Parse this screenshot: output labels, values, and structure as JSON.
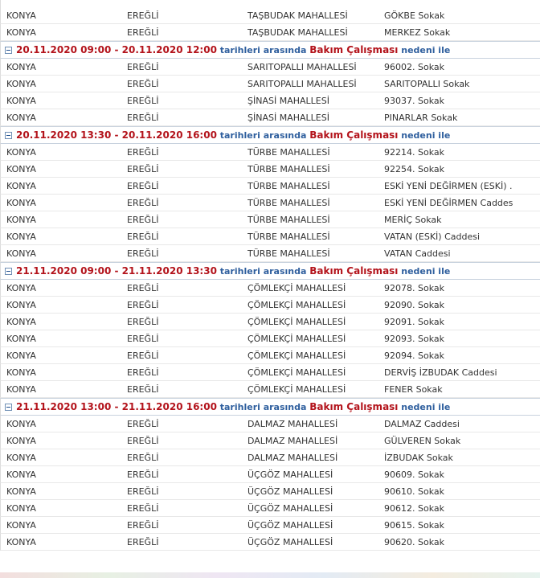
{
  "groups": [
    {
      "header": null,
      "rows": [
        [
          "KONYA",
          "EREĞLİ",
          "TAŞBUDAK MAHALLESİ",
          "GÖKBE Sokak"
        ],
        [
          "KONYA",
          "EREĞLİ",
          "TAŞBUDAK MAHALLESİ",
          "MERKEZ Sokak"
        ]
      ]
    },
    {
      "header": {
        "dates": "20.11.2020 09:00 - 20.11.2020 12:00",
        "between": "tarihleri arasında",
        "reason": "Bakım Çalışması",
        "suffix": "nedeni ile"
      },
      "rows": [
        [
          "KONYA",
          "EREĞLİ",
          "SARITOPALLI MAHALLESİ",
          "96002. Sokak"
        ],
        [
          "KONYA",
          "EREĞLİ",
          "SARITOPALLI MAHALLESİ",
          "SARITOPALLI Sokak"
        ],
        [
          "KONYA",
          "EREĞLİ",
          "ŞİNASİ MAHALLESİ",
          "93037. Sokak"
        ],
        [
          "KONYA",
          "EREĞLİ",
          "ŞİNASİ MAHALLESİ",
          "PINARLAR Sokak"
        ]
      ]
    },
    {
      "header": {
        "dates": "20.11.2020 13:30 - 20.11.2020 16:00",
        "between": "tarihleri arasında",
        "reason": "Bakım Çalışması",
        "suffix": "nedeni ile"
      },
      "rows": [
        [
          "KONYA",
          "EREĞLİ",
          "TÜRBE MAHALLESİ",
          "92214. Sokak"
        ],
        [
          "KONYA",
          "EREĞLİ",
          "TÜRBE MAHALLESİ",
          "92254. Sokak"
        ],
        [
          "KONYA",
          "EREĞLİ",
          "TÜRBE MAHALLESİ",
          "ESKİ YENİ DEĞİRMEN (ESKİ) ..."
        ],
        [
          "KONYA",
          "EREĞLİ",
          "TÜRBE MAHALLESİ",
          "ESKİ YENİ DEĞİRMEN Caddesi"
        ],
        [
          "KONYA",
          "EREĞLİ",
          "TÜRBE MAHALLESİ",
          "MERİÇ Sokak"
        ],
        [
          "KONYA",
          "EREĞLİ",
          "TÜRBE MAHALLESİ",
          "VATAN (ESKİ) Caddesi"
        ],
        [
          "KONYA",
          "EREĞLİ",
          "TÜRBE MAHALLESİ",
          "VATAN Caddesi"
        ]
      ]
    },
    {
      "header": {
        "dates": "21.11.2020 09:00 - 21.11.2020 13:30",
        "between": "tarihleri arasında",
        "reason": "Bakım Çalışması",
        "suffix": "nedeni ile"
      },
      "rows": [
        [
          "KONYA",
          "EREĞLİ",
          "ÇÖMLEKÇİ MAHALLESİ",
          "92078. Sokak"
        ],
        [
          "KONYA",
          "EREĞLİ",
          "ÇÖMLEKÇİ MAHALLESİ",
          "92090. Sokak"
        ],
        [
          "KONYA",
          "EREĞLİ",
          "ÇÖMLEKÇİ MAHALLESİ",
          "92091. Sokak"
        ],
        [
          "KONYA",
          "EREĞLİ",
          "ÇÖMLEKÇİ MAHALLESİ",
          "92093. Sokak"
        ],
        [
          "KONYA",
          "EREĞLİ",
          "ÇÖMLEKÇİ MAHALLESİ",
          "92094. Sokak"
        ],
        [
          "KONYA",
          "EREĞLİ",
          "ÇÖMLEKÇİ MAHALLESİ",
          "DERVİŞ İZBUDAK Caddesi"
        ],
        [
          "KONYA",
          "EREĞLİ",
          "ÇÖMLEKÇİ MAHALLESİ",
          "FENER Sokak"
        ]
      ]
    },
    {
      "header": {
        "dates": "21.11.2020 13:00 - 21.11.2020 16:00",
        "between": "tarihleri arasında",
        "reason": "Bakım Çalışması",
        "suffix": "nedeni ile"
      },
      "rows": [
        [
          "KONYA",
          "EREĞLİ",
          "DALMAZ MAHALLESİ",
          "DALMAZ Caddesi"
        ],
        [
          "KONYA",
          "EREĞLİ",
          "DALMAZ MAHALLESİ",
          "GÜLVEREN Sokak"
        ],
        [
          "KONYA",
          "EREĞLİ",
          "DALMAZ MAHALLESİ",
          "İZBUDAK Sokak"
        ],
        [
          "KONYA",
          "EREĞLİ",
          "ÜÇGÖZ MAHALLESİ",
          "90609. Sokak"
        ],
        [
          "KONYA",
          "EREĞLİ",
          "ÜÇGÖZ MAHALLESİ",
          "90610. Sokak"
        ],
        [
          "KONYA",
          "EREĞLİ",
          "ÜÇGÖZ MAHALLESİ",
          "90612. Sokak"
        ],
        [
          "KONYA",
          "EREĞLİ",
          "ÜÇGÖZ MAHALLESİ",
          "90615. Sokak"
        ],
        [
          "KONYA",
          "EREĞLİ",
          "ÜÇGÖZ MAHALLESİ",
          "90620. Sokak"
        ]
      ]
    }
  ],
  "colors": {
    "date_red": "#b3131b",
    "label_blue": "#2f5f9e",
    "toggle_border": "#6f8fb5"
  },
  "icons": {
    "group_toggle": "collapse-minus-icon"
  }
}
